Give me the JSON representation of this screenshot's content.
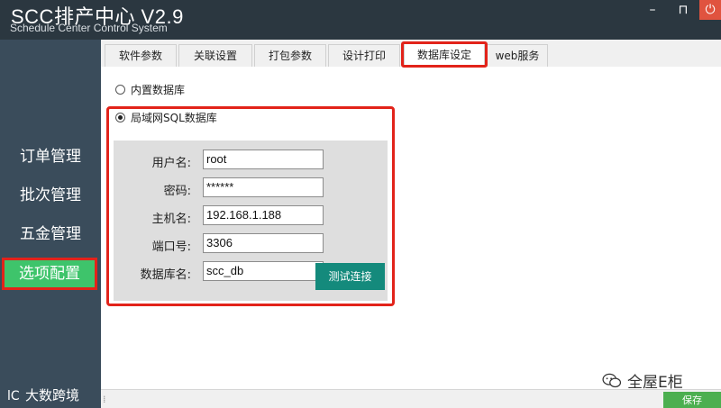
{
  "window": {
    "title": "SCC排产中心 V2.9",
    "subtitle": "Schedule Center Control System",
    "min_glyph": "–",
    "max_glyph": "⊓",
    "close_glyph": "⏻"
  },
  "sidebar": {
    "items": [
      {
        "label": "订单管理"
      },
      {
        "label": "批次管理"
      },
      {
        "label": "五金管理"
      },
      {
        "label": "选项配置"
      }
    ],
    "brand": "大数跨境",
    "brand_icon": "brand-logo-icon"
  },
  "tabs": [
    {
      "label": "软件参数"
    },
    {
      "label": "关联设置"
    },
    {
      "label": "打包参数"
    },
    {
      "label": "设计打印"
    },
    {
      "label": "数据库设定"
    },
    {
      "label": "web服务"
    }
  ],
  "db": {
    "option_builtin": "内置数据库",
    "option_lan": "局域网SQL数据库",
    "fields": [
      {
        "label": "用户名:",
        "value": "root"
      },
      {
        "label": "密码:",
        "value": "******"
      },
      {
        "label": "主机名:",
        "value": "192.168.1.188"
      },
      {
        "label": "端口号:",
        "value": "3306"
      },
      {
        "label": "数据库名:",
        "value": "scc_db"
      }
    ],
    "test_button": "测试连接"
  },
  "statusbar": {
    "grip": "⁞",
    "save_button": "保存"
  },
  "watermark": {
    "text": "全屋E柜",
    "icon": "wechat-icon"
  },
  "colors": {
    "accent_green": "#3ec46b",
    "highlight_red": "#e2231a",
    "teal_button": "#148a7c"
  }
}
